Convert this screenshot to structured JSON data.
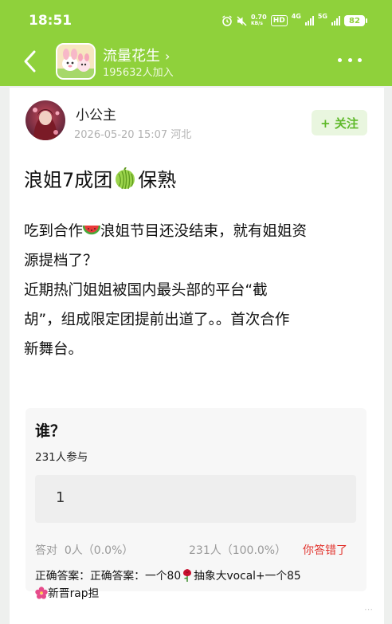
{
  "status_bar": {
    "time": "18:51",
    "net_speed_top": "0.70",
    "net_speed_unit": "KB/s",
    "network_badge": "HD",
    "network_4g": "4G",
    "network_5g": "5G",
    "battery": "82"
  },
  "header": {
    "group_name": "流量花生",
    "chevron": "›",
    "member_count": "195632人加入"
  },
  "post": {
    "author": "小公主",
    "meta": "2026-05-20 15:07  河北",
    "follow_label": "+ 关注",
    "title_part1": "浪姐7成团",
    "title_part2": "保熟",
    "body_line1_a": "吃到合作",
    "body_line1_b": "浪姐节目还没结束，就有姐姐资",
    "body_line2": "源提档了？",
    "body_line3": "近期热门姐姐被国内最头部的平台“截",
    "body_line4": "胡”，组成限定团提前出道了。。首次合作",
    "body_line5": "新舞台。"
  },
  "quiz": {
    "title": "谁？",
    "participants": "231人参与",
    "answer": "1",
    "correct_stat": "答对  0人（0.0%）",
    "wrong_stat": "231人（100.0%）",
    "result": "你答错了",
    "solution_a": "正确答案：正确答案：一个80",
    "solution_b": "抽象大vocal+一个85",
    "solution_c": "新晋rap担"
  },
  "icons": {
    "back": "back-arrow-icon",
    "more": "more-dots-icon",
    "melon": "melon-emoji-icon",
    "watermelon": "watermelon-emoji-icon",
    "rose": "rose-emoji-icon",
    "hibiscus": "hibiscus-emoji-icon"
  },
  "colors": {
    "brand_green": "#8fd13b",
    "follow_text": "#5fb92a",
    "wrong_red": "#e2352f"
  }
}
